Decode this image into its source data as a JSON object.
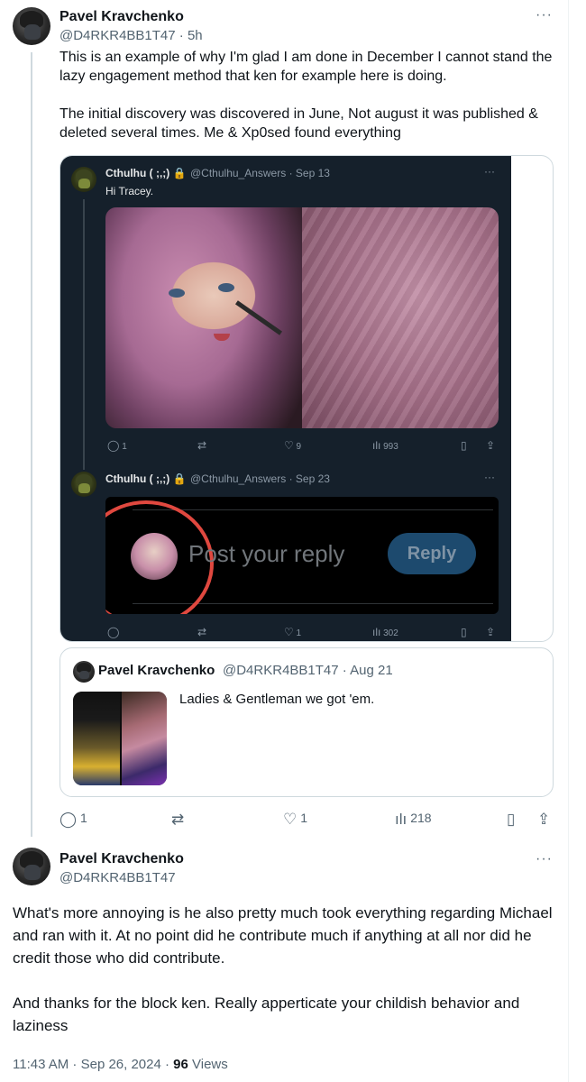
{
  "tweet1": {
    "name": "Pavel Kravchenko",
    "handle": "@D4RKR4BB1T47 · 5h",
    "para1": "This is an example of why I'm glad I am done in December I cannot stand the lazy engagement method that ken for example here is doing.",
    "para2": "The initial discovery was discovered in June, Not august it was published & deleted several times. Me & Xp0sed found everything",
    "more": "···"
  },
  "screenshot": {
    "post1": {
      "name": "Cthulhu ( ;,;) 🔒",
      "handle": "@Cthulhu_Answers · Sep 13",
      "text": "Hi Tracey.",
      "replies": "1",
      "likes": "9",
      "views": "993"
    },
    "post2": {
      "name": "Cthulhu ( ;,;) 🔒",
      "handle": "@Cthulhu_Answers · Sep 23",
      "reply_placeholder": "Post your reply",
      "reply_button": "Reply",
      "likes": "1",
      "views": "302"
    },
    "more": "···"
  },
  "quote": {
    "name": "Pavel Kravchenko",
    "handle": "@D4RKR4BB1T47 · Aug 21",
    "text": "Ladies & Gentleman we got 'em."
  },
  "tweet1_actions": {
    "replies": "1",
    "likes": "1",
    "views": "218"
  },
  "tweet2": {
    "name": "Pavel Kravchenko",
    "handle": "@D4RKR4BB1T47",
    "para1": "What's more annoying is he also pretty much took everything regarding Michael and ran with it. At no point did he contribute much if anything at all nor did he credit those who did contribute.",
    "para2": "And thanks for the block ken. Really apperticate your childish behavior and laziness",
    "time": "11:43 AM · Sep 26, 2024 · ",
    "views_count": "96",
    "views_label": " Views",
    "more": "···"
  },
  "icons": {
    "reply": "reply-icon",
    "retweet": "retweet-icon",
    "like": "heart-icon",
    "views": "views-icon",
    "bookmark": "bookmark-icon",
    "share": "share-icon"
  }
}
